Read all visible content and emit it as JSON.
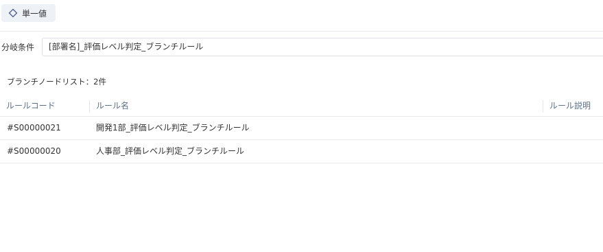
{
  "tag": {
    "icon": "diamond-icon",
    "label": "単一値",
    "icon_color": "#4a5d8a"
  },
  "condition": {
    "label": "分岐条件",
    "value": "[部署名]_評価レベル判定_ブランチルール"
  },
  "list": {
    "caption": "ブランチノードリスト：2件"
  },
  "table": {
    "headers": {
      "code": "ルールコード",
      "name": "ルール名",
      "description": "ルール説明"
    },
    "rows": [
      {
        "code": "#S00000021",
        "name": "開発1部_評価レベル判定_ブランチルール",
        "description": ""
      },
      {
        "code": "#S00000020",
        "name": "人事部_評価レベル判定_ブランチルール",
        "description": ""
      }
    ]
  }
}
